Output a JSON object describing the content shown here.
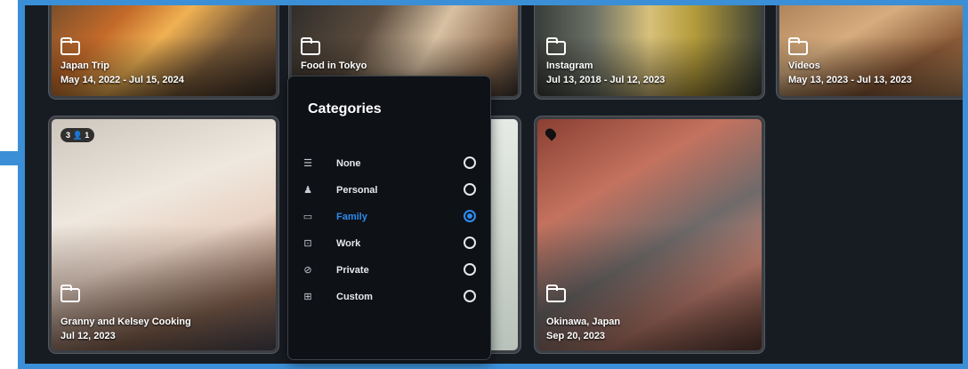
{
  "albums": [
    {
      "title": "Japan Trip",
      "date": "May 14, 2022 - Jul 15, 2024"
    },
    {
      "title": "Food in Tokyo",
      "date": ""
    },
    {
      "title": "Instagram",
      "date": "Jul 13, 2018 - Jul 12, 2023"
    },
    {
      "title": "Videos",
      "date": "May 13, 2023 - Jul 13, 2023"
    },
    {
      "title": "Granny and Kelsey Cooking",
      "date": "Jul 12, 2023",
      "badge": "3 👤 1"
    },
    {
      "title": "Okinawa, Japan",
      "date": "Sep 20, 2023"
    }
  ],
  "menu": {
    "title": "Categories",
    "options": [
      {
        "label": "None",
        "icon": "list-icon",
        "selected": false
      },
      {
        "label": "Personal",
        "icon": "person-icon",
        "selected": false
      },
      {
        "label": "Family",
        "icon": "family-icon",
        "selected": true
      },
      {
        "label": "Work",
        "icon": "briefcase-icon",
        "selected": false
      },
      {
        "label": "Private",
        "icon": "private-icon",
        "selected": false
      },
      {
        "label": "Custom",
        "icon": "custom-icon",
        "selected": false
      }
    ]
  },
  "colors": {
    "accent": "#2e8bf0",
    "frame": "#3b8fd6",
    "background": "#171b22"
  }
}
